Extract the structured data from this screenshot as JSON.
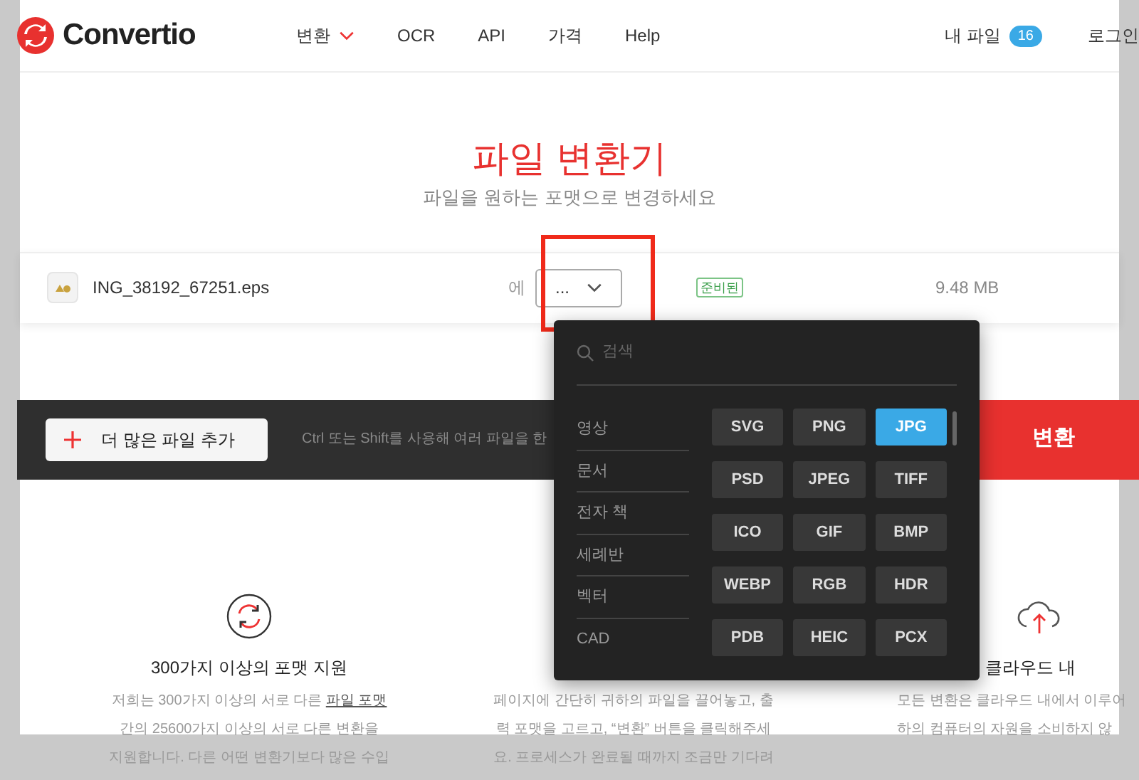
{
  "header": {
    "logo": "Convertio",
    "nav": [
      {
        "label": "변환",
        "dropdown": true
      },
      {
        "label": "OCR",
        "dropdown": false
      },
      {
        "label": "API",
        "dropdown": false
      },
      {
        "label": "가격",
        "dropdown": false
      },
      {
        "label": "Help",
        "dropdown": false
      }
    ],
    "my_files": {
      "label": "내 파일",
      "count": "16"
    },
    "login": "로그인"
  },
  "hero": {
    "title": "파일 변환기",
    "subtitle": "파일을 원하는 포맷으로 변경하세요"
  },
  "file": {
    "name": "ING_38192_67251.eps",
    "to_label": "에",
    "format": "...",
    "status": "준비된",
    "size": "9.48 MB"
  },
  "bar": {
    "add_button": "더 많은 파일 추가",
    "hint": "Ctrl 또는 Shift를 사용해 여러 파일을 한",
    "convert_button": "변환"
  },
  "dropdown": {
    "search_placeholder": "검색",
    "categories": [
      {
        "label": "영상",
        "selected": false
      },
      {
        "label": "문서",
        "selected": false
      },
      {
        "label": "전자 책",
        "selected": false
      },
      {
        "label": "세례반",
        "selected": false
      },
      {
        "label": "벡터",
        "selected": false
      },
      {
        "label": "CAD",
        "selected": false
      }
    ],
    "formats": [
      {
        "label": "SVG",
        "selected": false
      },
      {
        "label": "PNG",
        "selected": false
      },
      {
        "label": "JPG",
        "selected": true
      },
      {
        "label": "PSD",
        "selected": false
      },
      {
        "label": "JPEG",
        "selected": false
      },
      {
        "label": "TIFF",
        "selected": false
      },
      {
        "label": "ICO",
        "selected": false
      },
      {
        "label": "GIF",
        "selected": false
      },
      {
        "label": "BMP",
        "selected": false
      },
      {
        "label": "WEBP",
        "selected": false
      },
      {
        "label": "RGB",
        "selected": false
      },
      {
        "label": "HDR",
        "selected": false
      },
      {
        "label": "PDB",
        "selected": false
      },
      {
        "label": "HEIC",
        "selected": false
      },
      {
        "label": "PCX",
        "selected": false
      }
    ]
  },
  "features": [
    {
      "kind": "formats",
      "title": "300가지 이상의 포맷 지원",
      "lines": [
        "저희는 300가지 이상의 서로 다른 **파일 포맷**",
        "간의 25600가지 이상의 서로 다른 변환을",
        "지원합니다. 다른 어떤 변환기보다 많은 수입"
      ]
    },
    {
      "kind": "easy",
      "lines": [
        "페이지에 간단히 귀하의 파일을 끌어놓고, 출",
        "력 포맷을 고르고, “변환” 버튼을 클릭해주세",
        "요. 프로세스가 완료될 때까지 조금만 기다려"
      ]
    },
    {
      "kind": "cloud",
      "title": "클라우드 내",
      "lines": [
        "모든 변환은 클라우드 내에서 이루어",
        "하의 컴퓨터의 자원을 소비하지 않"
      ]
    }
  ]
}
